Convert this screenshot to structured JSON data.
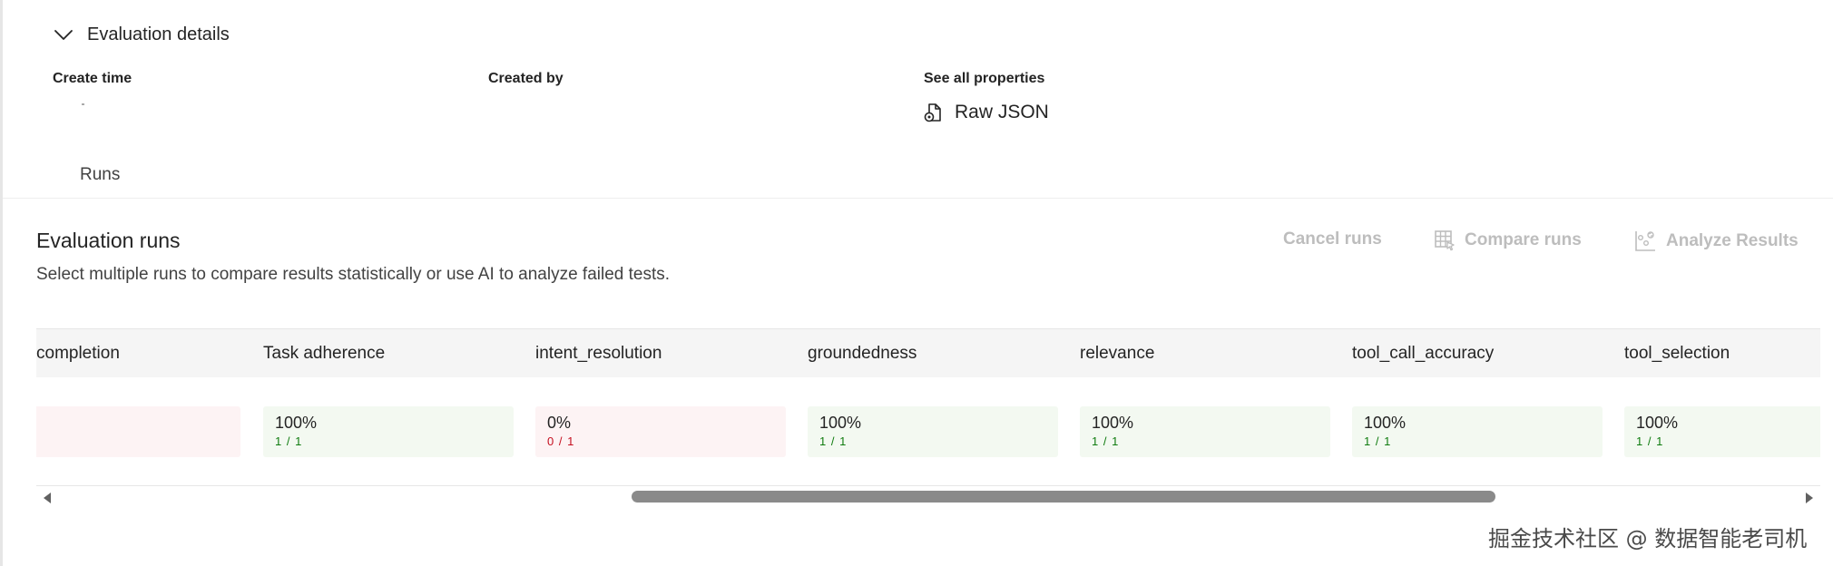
{
  "details": {
    "title": "Evaluation details",
    "create_time_label": "Create time",
    "created_by_label": "Created by",
    "properties_label": "See all properties",
    "raw_json_label": "Raw JSON"
  },
  "tabs": {
    "runs": "Runs"
  },
  "section": {
    "title": "Evaluation runs",
    "subtitle": "Select multiple runs to compare results statistically or use AI to analyze failed tests."
  },
  "toolbar": {
    "cancel_runs": "Cancel runs",
    "compare_runs": "Compare runs",
    "analyze_results": "Analyze Results",
    "disabled_color": "#bdbdbd"
  },
  "table": {
    "columns": [
      "completion",
      "Task adherence",
      "intent_resolution",
      "groundedness",
      "relevance",
      "tool_call_accuracy",
      "tool_selection"
    ],
    "cells": [
      {
        "percent": "",
        "fraction": "",
        "status": "fail"
      },
      {
        "percent": "100%",
        "fraction": "1 / 1",
        "status": "pass"
      },
      {
        "percent": "0%",
        "fraction": "0 / 1",
        "status": "fail"
      },
      {
        "percent": "100%",
        "fraction": "1 / 1",
        "status": "pass"
      },
      {
        "percent": "100%",
        "fraction": "1 / 1",
        "status": "pass"
      },
      {
        "percent": "100%",
        "fraction": "1 / 1",
        "status": "pass"
      },
      {
        "percent": "100%",
        "fraction": "1 / 1",
        "status": "pass"
      }
    ],
    "pass_color": "#107c10",
    "fail_color": "#c50f1f"
  },
  "watermark": "掘金技术社区 @ 数据智能老司机"
}
